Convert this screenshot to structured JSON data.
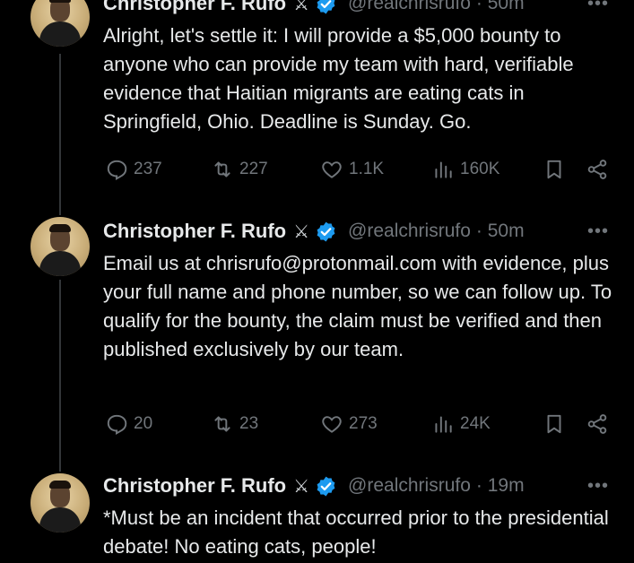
{
  "tweets": [
    {
      "name": "Christopher F. Rufo",
      "handle": "@realchrisrufo",
      "time": "· 50m",
      "text": "Alright, let's settle it: I will provide a $5,000 bounty to anyone who can provide my team with hard, verifiable evidence that Haitian migrants are eating cats in Springfield, Ohio. Deadline is Sunday. Go.",
      "replies": "237",
      "reposts": "227",
      "likes": "1.1K",
      "views": "160K"
    },
    {
      "name": "Christopher F. Rufo",
      "handle": "@realchrisrufo",
      "time": "· 50m",
      "text": "Email us at chrisrufo@protonmail.com with evidence, plus your full name and phone number, so we can follow up. To qualify for the bounty, the claim must be verified and then published exclusively by our team.",
      "replies": "20",
      "reposts": "23",
      "likes": "273",
      "views": "24K"
    },
    {
      "name": "Christopher F. Rufo",
      "handle": "@realchrisrufo",
      "time": "· 19m",
      "text": "*Must be an incident that occurred prior to the presidential debate! No eating cats, people!"
    }
  ],
  "icons": {
    "reply": "reply-icon",
    "repost": "repost-icon",
    "like": "heart-icon",
    "views": "views-icon",
    "bookmark": "bookmark-icon",
    "share": "share-icon",
    "verified": "verified-badge-icon",
    "more": "more-icon"
  },
  "colors": {
    "background": "#000000",
    "text": "#e7e9ea",
    "muted": "#71767b",
    "verified": "#1d9bf0"
  }
}
